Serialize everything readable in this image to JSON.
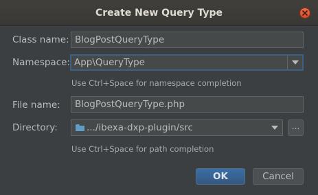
{
  "dialog": {
    "title": "Create New Query Type"
  },
  "form": {
    "class_name": {
      "label": "Class name:",
      "value": "BlogPostQueryType"
    },
    "namespace": {
      "label": "Namespace:",
      "value": "App\\QueryType",
      "hint": "Use Ctrl+Space for namespace completion"
    },
    "file_name": {
      "label": "File name:",
      "value": "BlogPostQueryType.php"
    },
    "directory": {
      "label": "Directory:",
      "value": ".../ibexa-dxp-plugin/src",
      "browse_label": "...",
      "hint": "Use Ctrl+Space for path completion",
      "icon": "folder-icon"
    }
  },
  "buttons": {
    "ok": "OK",
    "cancel": "Cancel"
  },
  "colors": {
    "accent": "#365880",
    "focus_border": "#3d6185",
    "close_button": "#e05a36",
    "folder": "#5f9dc7"
  }
}
